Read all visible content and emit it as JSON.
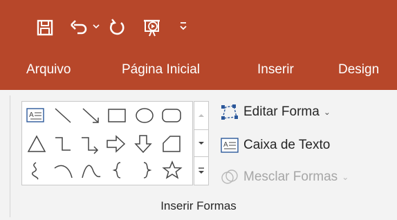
{
  "qat": {
    "icons": [
      "save-icon",
      "undo-icon",
      "undo-dropdown-icon",
      "redo-icon",
      "presentation-from-start-icon",
      "customize-qat-icon"
    ]
  },
  "tabs": [
    {
      "label": "Arquivo"
    },
    {
      "label": "Página Inicial"
    },
    {
      "label": "Inserir"
    },
    {
      "label": "Design"
    }
  ],
  "shapes_gallery": {
    "rows": [
      [
        "text-box-shape",
        "line-shape",
        "arrow-line-shape",
        "rectangle-shape",
        "oval-shape",
        "rounded-rectangle-shape"
      ],
      [
        "triangle-shape",
        "elbow-connector-shape",
        "elbow-arrow-connector-shape",
        "right-arrow-shape",
        "down-arrow-shape",
        "folded-corner-shape"
      ],
      [
        "freeform-curve-shape",
        "arc-shape",
        "curve-shape",
        "left-brace-shape",
        "right-brace-shape",
        "star-shape"
      ]
    ]
  },
  "commands": {
    "edit_shape": {
      "label": "Editar Forma",
      "icon": "edit-shape-icon",
      "enabled": true
    },
    "text_box": {
      "label": "Caixa de Texto",
      "icon": "text-box-icon",
      "enabled": true
    },
    "merge_shapes": {
      "label": "Mesclar Formas",
      "icon": "merge-shapes-icon",
      "enabled": false
    }
  },
  "group": {
    "label": "Inserir Formas"
  },
  "colors": {
    "title_bar": "#b7472a",
    "ribbon": "#f3f3f3",
    "text": "#262626",
    "disabled_text": "#a6a6a6",
    "accent_blue": "#2b579a"
  }
}
